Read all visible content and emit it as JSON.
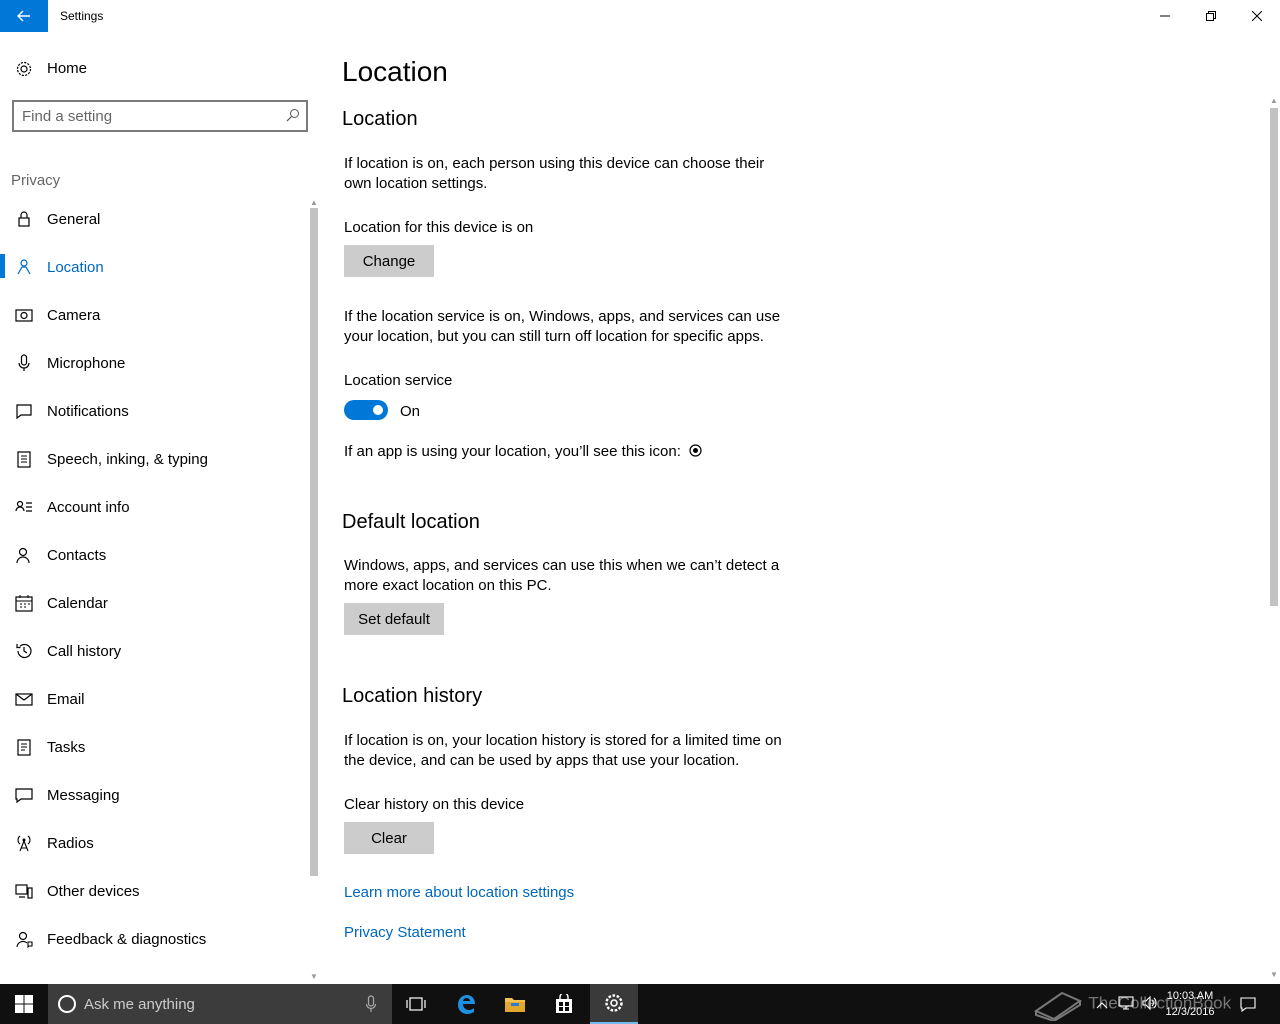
{
  "window": {
    "title": "Settings"
  },
  "sidebar": {
    "home_label": "Home",
    "search_placeholder": "Find a setting",
    "group_label": "Privacy",
    "items": [
      {
        "label": "General",
        "icon": "lock-icon"
      },
      {
        "label": "Location",
        "icon": "location-person-icon",
        "selected": true
      },
      {
        "label": "Camera",
        "icon": "camera-icon"
      },
      {
        "label": "Microphone",
        "icon": "microphone-icon"
      },
      {
        "label": "Notifications",
        "icon": "notifications-icon"
      },
      {
        "label": "Speech, inking, & typing",
        "icon": "clipboard-icon"
      },
      {
        "label": "Account info",
        "icon": "account-info-icon"
      },
      {
        "label": "Contacts",
        "icon": "contacts-icon"
      },
      {
        "label": "Calendar",
        "icon": "calendar-icon"
      },
      {
        "label": "Call history",
        "icon": "history-icon"
      },
      {
        "label": "Email",
        "icon": "email-icon"
      },
      {
        "label": "Tasks",
        "icon": "tasks-icon"
      },
      {
        "label": "Messaging",
        "icon": "messaging-icon"
      },
      {
        "label": "Radios",
        "icon": "radio-tower-icon"
      },
      {
        "label": "Other devices",
        "icon": "other-devices-icon"
      },
      {
        "label": "Feedback & diagnostics",
        "icon": "feedback-icon"
      }
    ]
  },
  "main": {
    "page_title": "Location",
    "location": {
      "title": "Location",
      "description": "If location is on, each person using this device can choose their own location settings.",
      "device_status": "Location for this device is on",
      "change_button": "Change",
      "service_description": "If the location service is on, Windows, apps, and services can use your location, but you can still turn off location for specific apps.",
      "service_label": "Location service",
      "service_state": "On",
      "service_on": true,
      "icon_note": "If an app is using your location, you’ll see this icon:"
    },
    "default_location": {
      "title": "Default location",
      "description": "Windows, apps, and services can use this when we can’t detect a more exact location on this PC.",
      "button": "Set default"
    },
    "history": {
      "title": "Location history",
      "description": "If location is on, your location history is stored for a limited time on the device, and can be used by apps that use your location.",
      "clear_label": "Clear history on this device",
      "clear_button": "Clear"
    },
    "links": {
      "learn_more": "Learn more about location settings",
      "privacy": "Privacy Statement"
    }
  },
  "taskbar": {
    "search_text": "Ask me anything",
    "time": "10:03 AM",
    "date": "12/3/2016",
    "watermark": "TheCollectionBook",
    "accent": "#0078d7"
  }
}
